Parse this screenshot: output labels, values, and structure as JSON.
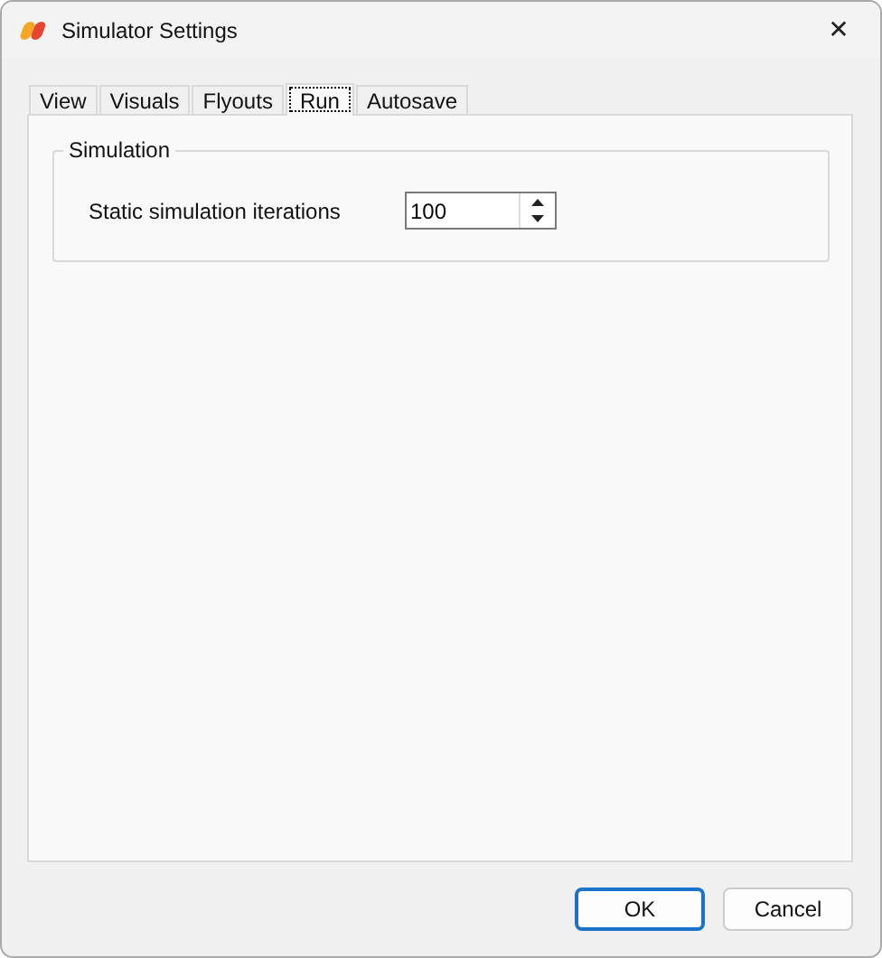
{
  "window": {
    "title": "Simulator Settings",
    "close": "✕"
  },
  "tabs": [
    {
      "label": "View",
      "selected": false
    },
    {
      "label": "Visuals",
      "selected": false
    },
    {
      "label": "Flyouts",
      "selected": false
    },
    {
      "label": "Run",
      "selected": true
    },
    {
      "label": "Autosave",
      "selected": false
    }
  ],
  "group": {
    "title": "Simulation",
    "field": {
      "label": "Static simulation iterations",
      "value": "100"
    }
  },
  "buttons": [
    {
      "label": "OK",
      "default": true
    },
    {
      "label": "Cancel",
      "default": false
    }
  ]
}
